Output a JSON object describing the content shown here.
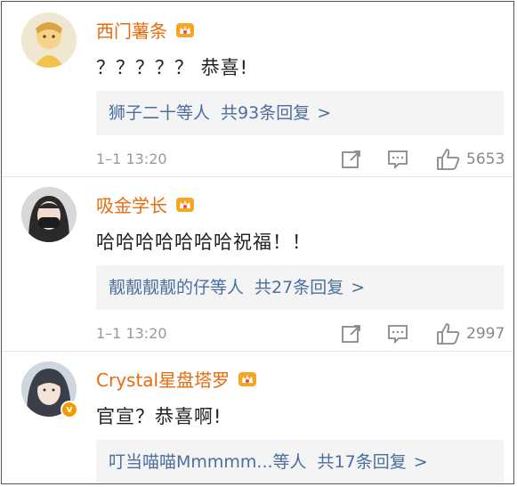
{
  "comments": [
    {
      "username": "西门薯条",
      "text": "？？？？？ 恭喜!",
      "replies_preview": "狮子二十等人",
      "replies_count": "共93条回复",
      "arrow": ">",
      "time": "1–1 13:20",
      "likes": "5653"
    },
    {
      "username": "吸金学长",
      "text": "哈哈哈哈哈哈哈祝福！！",
      "replies_preview": "靓靓靓靓的仔等人",
      "replies_count": "共27条回复",
      "arrow": ">",
      "time": "1–1 13:20",
      "likes": "2997"
    },
    {
      "username": "Crystal星盘塔罗",
      "text": "官宣？恭喜啊!",
      "replies_preview": "叮当喵喵Mmmmm...等人",
      "replies_count": "共17条回复",
      "arrow": ">",
      "verified_mark": "v"
    }
  ],
  "colors": {
    "username": "#e86b0c",
    "reply_link": "#4b6e9e",
    "reply_bg": "#f4f4f4",
    "meta": "#999999"
  }
}
